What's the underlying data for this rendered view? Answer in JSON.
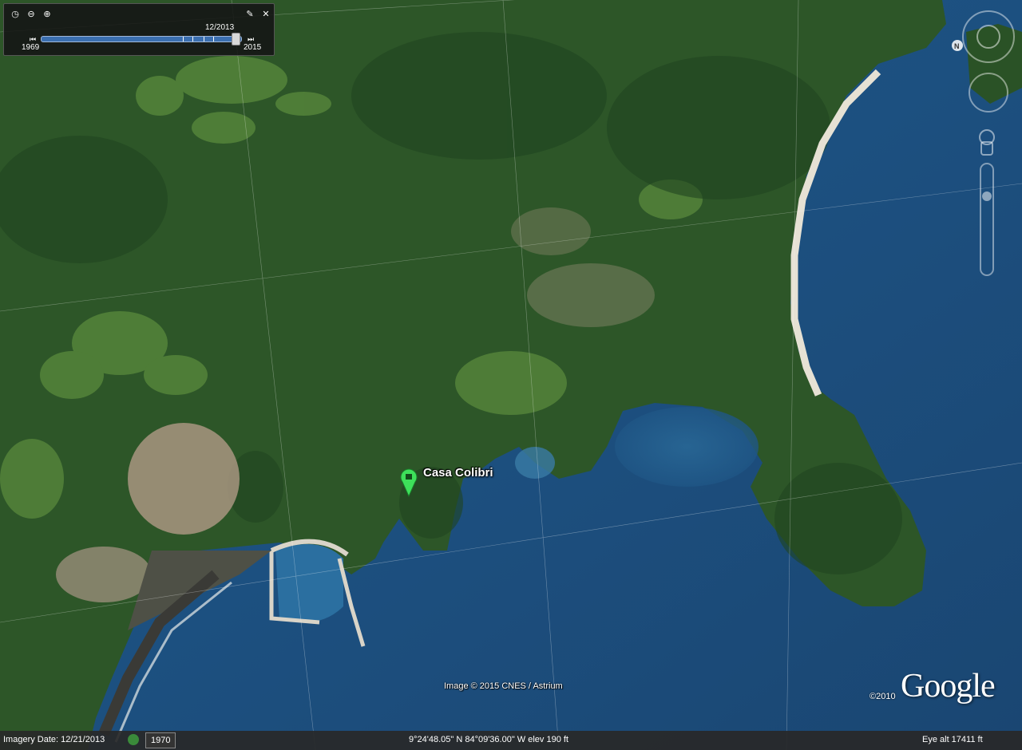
{
  "slider": {
    "date": "12/2013",
    "start_year": "1969",
    "end_year": "2015",
    "position_fraction": 0.98
  },
  "placemark": {
    "label": "Casa Colibri",
    "color": "#3ee05a"
  },
  "credits": {
    "image": "Image © 2015 CNES / Astrium",
    "copyright": "©2010",
    "logo": "Google"
  },
  "status": {
    "imagery_date": "Imagery Date: 12/21/2013",
    "year_button": "1970",
    "coordinates": "9°24'48.05\" N   84°09'36.00\" W   elev    190 ft",
    "eye_alt": "Eye alt    17411 ft"
  },
  "colors": {
    "ocean": "#1c4d7a",
    "forest": "#2f5a2a",
    "beach": "#e6e1d4"
  }
}
